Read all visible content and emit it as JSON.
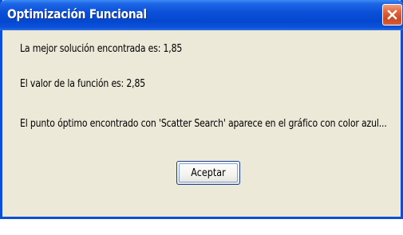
{
  "window": {
    "title": "Optimización Funcional",
    "close_icon": "close-x-icon",
    "accent_color": "#0a50d8",
    "close_color": "#d65e36"
  },
  "dialog": {
    "best_solution": "La mejor solución encontrada es: 1,85",
    "function_value": "El valor de la función es: 2,85",
    "optimum_note": "El punto óptimo encontrado con 'Scatter Search' aparece en el gráfico con color azul..."
  },
  "buttons": {
    "ok_label": "Aceptar"
  }
}
